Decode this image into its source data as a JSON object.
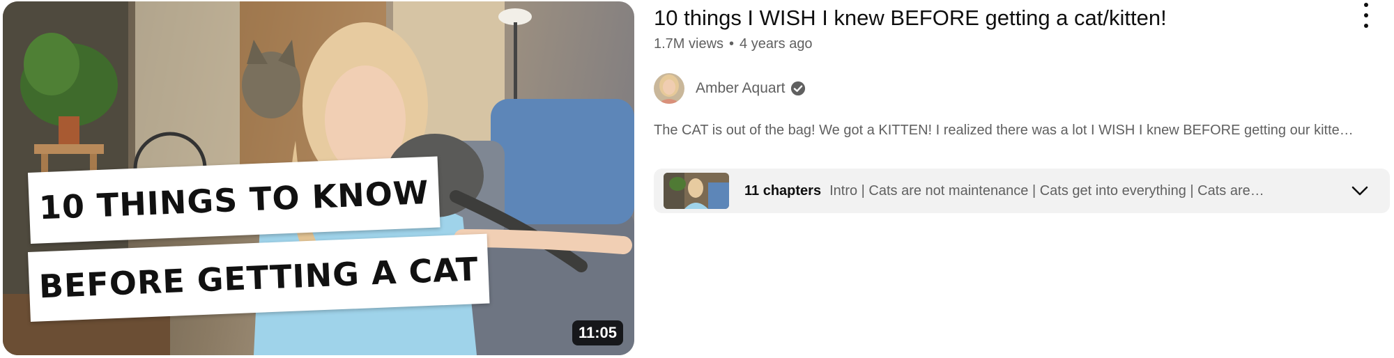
{
  "thumbnail": {
    "overlay_line_1": "10 THINGS TO KNOW",
    "overlay_line_2": "BEFORE GETTING A CAT",
    "duration": "11:05"
  },
  "video": {
    "title": "10 things I WISH I knew BEFORE getting a cat/kitten!",
    "views": "1.7M views",
    "separator": "•",
    "age": "4 years ago",
    "more_icon": "vertical-ellipsis-icon"
  },
  "channel": {
    "name": "Amber Aquart",
    "verified_icon": "verified-check-icon"
  },
  "description": "The CAT is out of the bag! We got a KITTEN! I realized there was a lot I WISH I knew BEFORE getting our kitte…",
  "chapters": {
    "count_label": "11 chapters",
    "list_text": "Intro | Cats are not maintenance | Cats get into everything | Cats are…",
    "expand_icon": "chevron-down-icon"
  },
  "colors": {
    "text_primary": "#0f0f0f",
    "text_secondary": "#606060",
    "chapters_bg": "#f2f2f2",
    "duration_bg": "#000000cc",
    "verified_fill": "#606060"
  }
}
